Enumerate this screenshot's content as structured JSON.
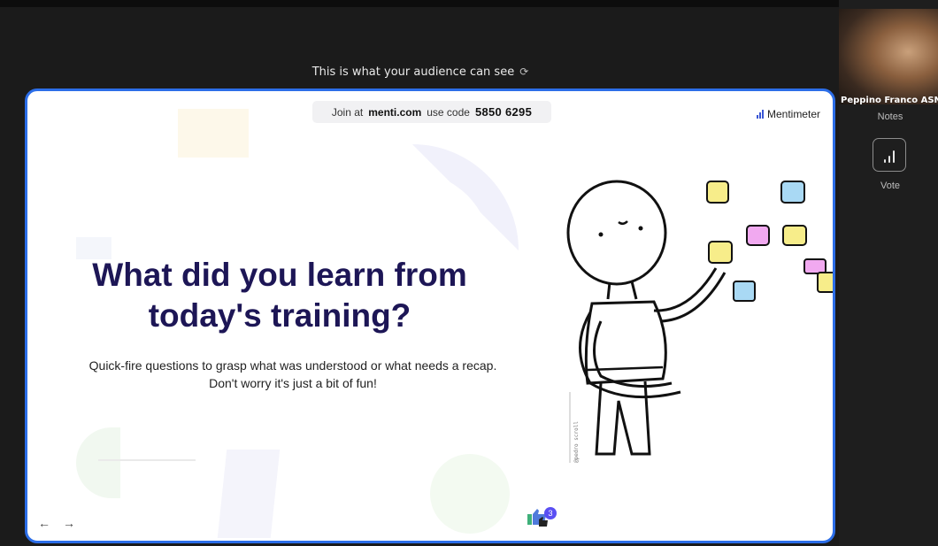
{
  "audience_note": "This is what your audience can see",
  "participant": {
    "name": "Peppino Franco ASN..."
  },
  "sidebar": {
    "notes_label": "Notes",
    "vote_label": "Vote"
  },
  "slide": {
    "join_prefix": "Join at",
    "join_site": "menti.com",
    "join_code_label": "use code",
    "join_code": "5850 6295",
    "brand": "Mentimeter",
    "title_line1": "What did you learn from",
    "title_line2": "today's training?",
    "subtitle_line1": "Quick-fire questions to grasp what was understood or what needs a recap.",
    "subtitle_line2": "Don't worry it's just a bit of fun!",
    "reaction_count": "3",
    "prev_arrow": "←",
    "next_arrow": "→",
    "signature": "@pedro scroll"
  },
  "colors": {
    "accent": "#2c6ee8",
    "title": "#1d1656",
    "brand_icon": "#3a56d4"
  }
}
